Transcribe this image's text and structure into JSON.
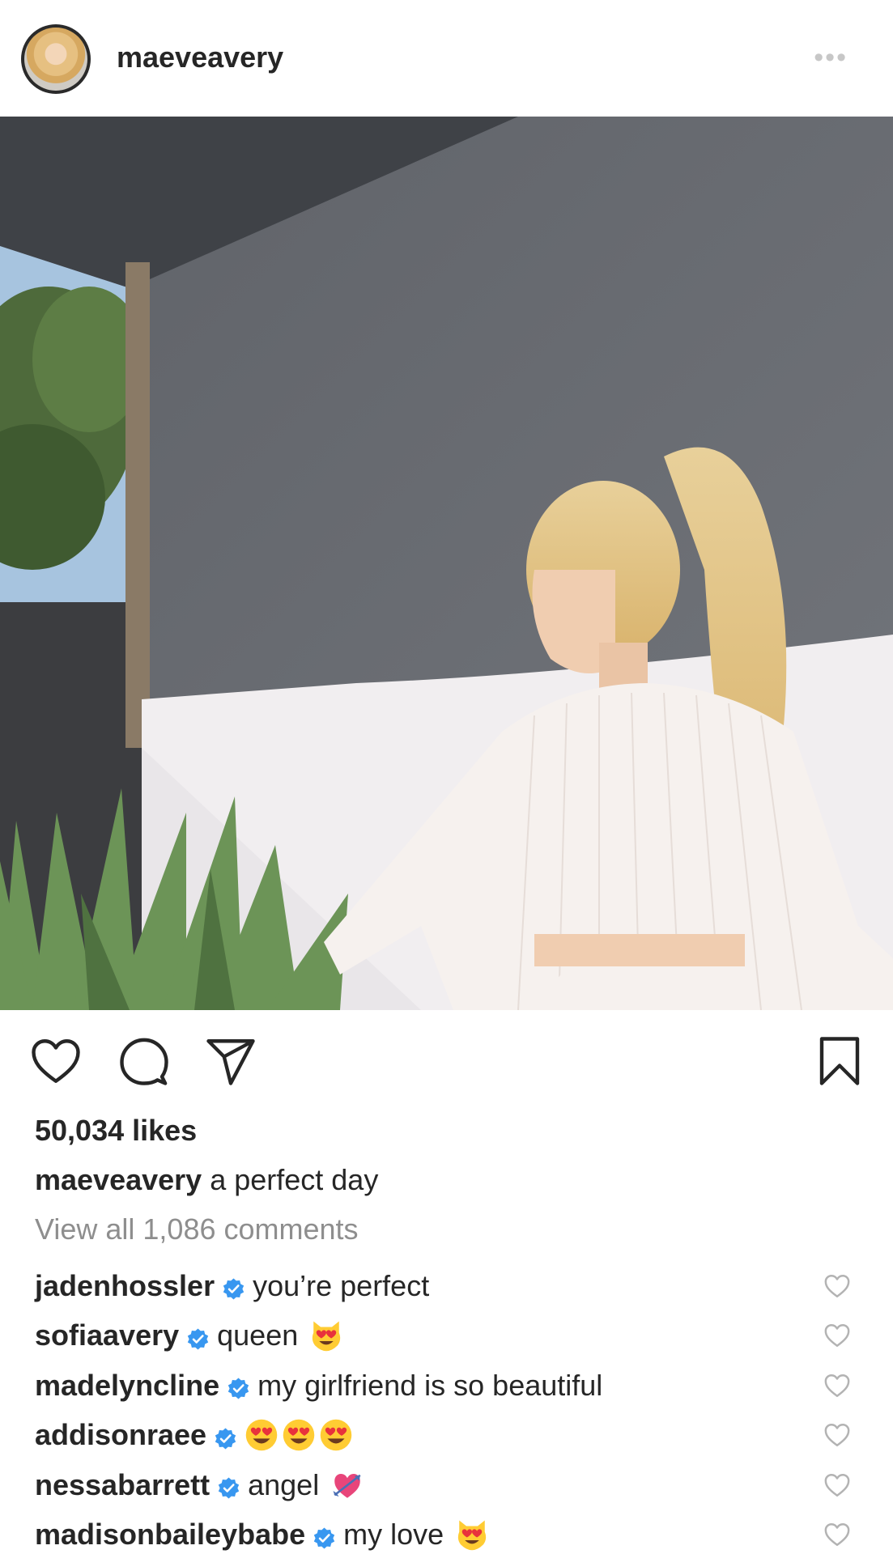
{
  "post": {
    "username": "maeveavery",
    "more_label": "•••",
    "likes": "50,034 likes",
    "caption_user": "maeveavery",
    "caption_text": " a perfect day",
    "view_all": "View all 1,086 comments"
  },
  "icons": {
    "like": "heart-outline-icon",
    "comment": "comment-bubble-icon",
    "share": "paper-plane-icon",
    "save": "bookmark-icon",
    "verified": "verified-badge-icon",
    "comment_like": "heart-outline-icon"
  },
  "colors": {
    "text": "#262626",
    "muted": "#8e8e8e",
    "verified": "#3897f0",
    "icon_gray": "#b3b3b3"
  },
  "comments": [
    {
      "user": "jadenhossler",
      "verified": true,
      "text": "you’re perfect",
      "emojis": []
    },
    {
      "user": "sofiaavery",
      "verified": true,
      "text": "queen",
      "emojis": [
        "heart-eyes-cat"
      ]
    },
    {
      "user": "madelyncline",
      "verified": true,
      "text": "my girlfriend is so beautiful",
      "emojis": []
    },
    {
      "user": "addisonraee",
      "verified": true,
      "text": "",
      "emojis": [
        "heart-eyes",
        "heart-eyes",
        "heart-eyes"
      ]
    },
    {
      "user": "nessabarrett",
      "verified": true,
      "text": "angel",
      "emojis": [
        "heart-with-arrow"
      ]
    },
    {
      "user": "madisonbaileybabe",
      "verified": true,
      "text": "my love",
      "emojis": [
        "heart-eyes-cat"
      ]
    }
  ]
}
